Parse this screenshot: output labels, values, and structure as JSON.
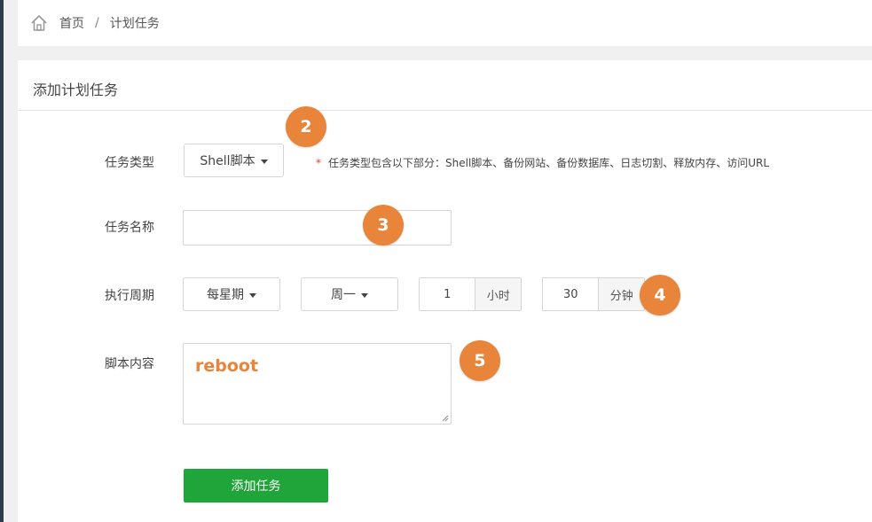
{
  "breadcrumb": {
    "home": "首页",
    "separator": "/",
    "current": "计划任务"
  },
  "panel": {
    "title": "添加计划任务"
  },
  "form": {
    "task_type": {
      "label": "任务类型",
      "selected": "Shell脚本",
      "hint_star": "*",
      "hint": "任务类型包含以下部分：Shell脚本、备份网站、备份数据库、日志切割、释放内存、访问URL"
    },
    "task_name": {
      "label": "任务名称",
      "value": ""
    },
    "schedule": {
      "label": "执行周期",
      "period": "每星期",
      "weekday": "周一",
      "hour_value": "1",
      "hour_unit": "小时",
      "minute_value": "30",
      "minute_unit": "分钟"
    },
    "script": {
      "label": "脚本内容",
      "value": "reboot"
    },
    "submit_label": "添加任务"
  },
  "annotations": {
    "badge_2": "2",
    "badge_3": "3",
    "badge_4": "4",
    "badge_5": "5"
  },
  "colors": {
    "accent_green": "#20a53a",
    "annotation_orange": "#e8853a",
    "required_red": "#e53935",
    "sidebar_dark": "#2f3b48"
  },
  "icons": {
    "home": "home-icon",
    "dropdown": "caret-down-icon",
    "resize": "resize-grip-icon"
  }
}
